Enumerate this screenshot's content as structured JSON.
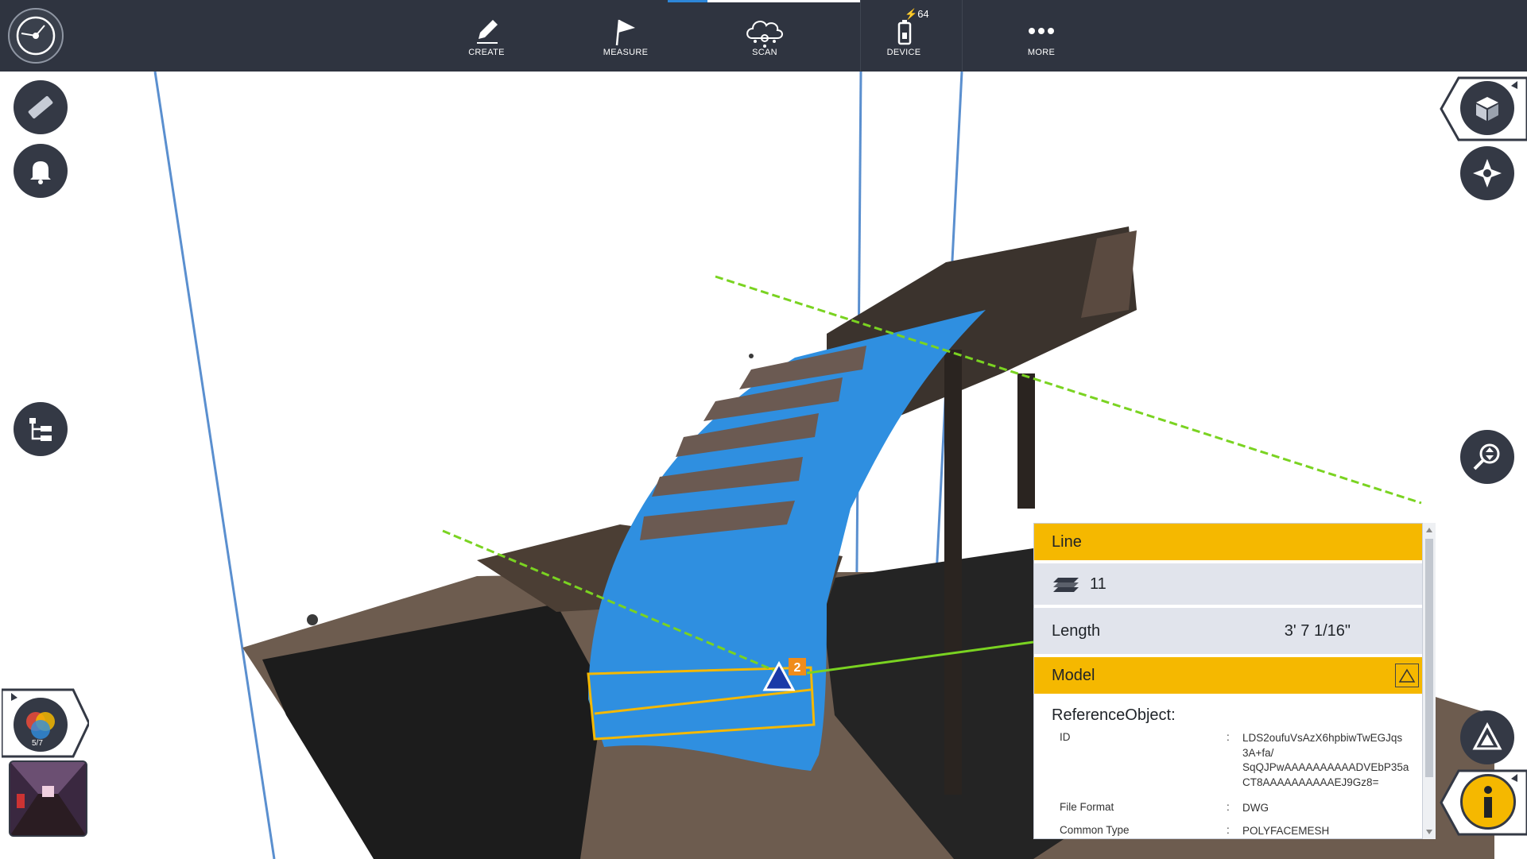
{
  "toolbar": {
    "items": [
      {
        "label": "CREATE",
        "icon": "pencil-icon"
      },
      {
        "label": "MEASURE",
        "icon": "flag-icon"
      },
      {
        "label": "SCAN",
        "icon": "cloud-scan-icon"
      },
      {
        "label": "DEVICE",
        "icon": "device-icon"
      },
      {
        "label": "MORE",
        "icon": "more-icon"
      }
    ],
    "battery_level": "64",
    "active_item": "SCAN"
  },
  "left_tools": {
    "scan_counter": "5/7"
  },
  "annotations": {
    "point_marker_number": "2"
  },
  "info_panel": {
    "line_header": "Line",
    "layer_value": "11",
    "length_label": "Length",
    "length_value": "3' 7 1/16\"",
    "model_header": "Model",
    "reference_label": "ReferenceObject:",
    "id_label": "ID",
    "id_value_lines": [
      "LDS2oufuVsAzX6hpbiwTwEGJqs",
      "3A+fa/",
      "SqQJPwAAAAAAAAAADVEbP35a",
      "CT8AAAAAAAAAAEJ9Gz8="
    ],
    "file_format_label": "File Format",
    "file_format_value": "DWG",
    "common_type_label": "Common Type",
    "common_type_value": "POLYFACEMESH"
  },
  "colors": {
    "toolbar_bg": "#2f3440",
    "accent_yellow": "#f5b800",
    "selection_blue": "#2f8fe0",
    "measure_green": "#7ad321",
    "cloud_dark": "#3b332d"
  }
}
